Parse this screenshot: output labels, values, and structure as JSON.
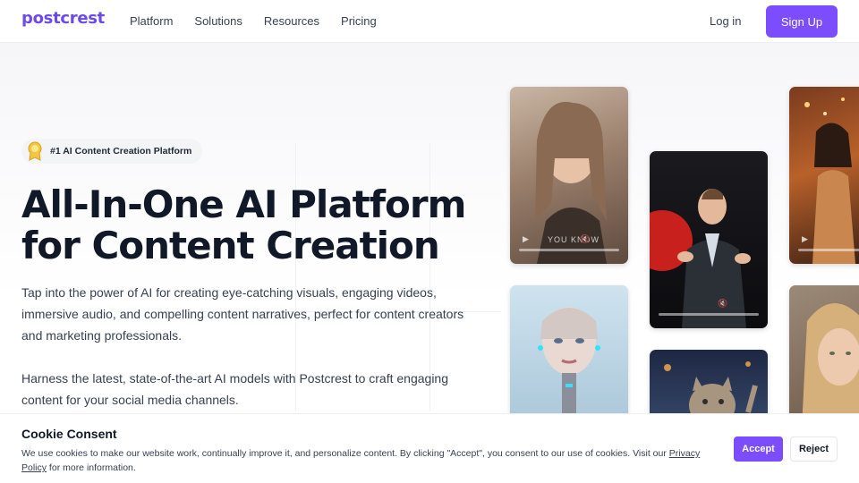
{
  "nav": {
    "logo": "postcrest",
    "links": [
      "Platform",
      "Solutions",
      "Resources",
      "Pricing"
    ],
    "login": "Log in",
    "signup": "Sign Up"
  },
  "hero": {
    "badge": "#1 AI Content Creation Platform",
    "headline_line1": "All-In-One AI Platform",
    "headline_line2": "for Content Creation",
    "paragraph1": "Tap into the power of AI for creating eye-catching visuals, engaging videos, immersive audio, and compelling content narratives, perfect for content creators and marketing professionals.",
    "paragraph2": "Harness the latest, state-of-the-art AI models with Postcrest to craft engaging content for your social media channels."
  },
  "media": {
    "card1_overlay": "YOU KNOW"
  },
  "cookie": {
    "title": "Cookie Consent",
    "text_before": "We use cookies to make our website work, continually improve it, and personalize content. By clicking \"Accept\", you consent to our use of cookies. Visit our ",
    "link": "Privacy Policy",
    "text_after": " for more information.",
    "accept": "Accept",
    "reject": "Reject"
  },
  "colors": {
    "brand": "#7c4dff",
    "logo": "#6d4ae8"
  }
}
